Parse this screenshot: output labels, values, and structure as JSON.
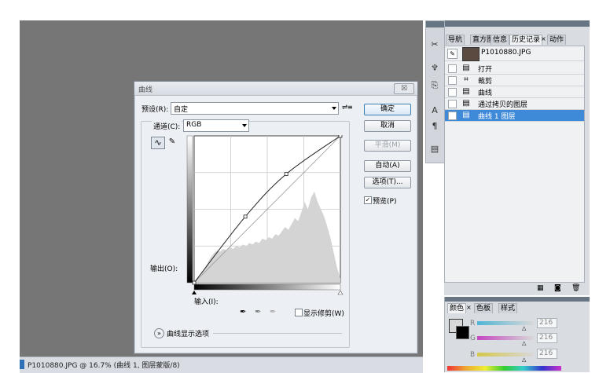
{
  "status": {
    "text": "P1010880.JPG @ 16.7% (曲线 1, 图层蒙版/8)"
  },
  "dialog": {
    "title": "曲线",
    "close_label": "☒",
    "preset_label": "预设(R):",
    "preset_value": "自定",
    "channel_label": "通道(C):",
    "channel_value": "RGB",
    "output_label": "输出(O):",
    "input_label": "输入(I):",
    "show_clipping_label": "显示修剪(W)",
    "curve_display_options_label": "曲线显示选项",
    "buttons": {
      "ok": "确定",
      "cancel": "取消",
      "smooth": "平滑(M)",
      "auto": "自动(A)",
      "options": "选项(T)...",
      "preview": "预览(P)"
    },
    "preview_checked": true,
    "show_clipping_checked": false,
    "curve_points": [
      [
        0,
        0
      ],
      [
        0.35,
        0.45
      ],
      [
        0.63,
        0.74
      ],
      [
        1,
        1
      ]
    ],
    "histogram_color": "#d4d4d4"
  },
  "panels": {
    "top_tabs": [
      "导航",
      "直方图",
      "信息",
      "历史记录",
      "动作"
    ],
    "history_snapshot": "P1010880.JPG",
    "history_items": [
      {
        "label": "打开",
        "icon": "document-icon"
      },
      {
        "label": "裁剪",
        "icon": "crop-icon"
      },
      {
        "label": "曲线",
        "icon": "document-icon"
      },
      {
        "label": "通过拷贝的图层",
        "icon": "document-icon"
      },
      {
        "label": "曲线 1 图层",
        "icon": "document-icon",
        "selected": true
      }
    ],
    "bottom_tabs": [
      "颜色",
      "色板",
      "样式"
    ],
    "color": {
      "r_label": "R",
      "g_label": "G",
      "b_label": "B",
      "r": "216",
      "g": "216",
      "b": "216"
    }
  },
  "colors": {
    "selection": "#3f8ad8",
    "workspace": "#767676",
    "panel": "#d9dde2"
  }
}
